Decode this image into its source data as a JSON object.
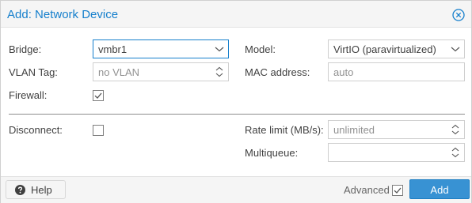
{
  "dialog": {
    "title": "Add: Network Device"
  },
  "fields": {
    "bridge": {
      "label": "Bridge:",
      "value": "vmbr1"
    },
    "vlan_tag": {
      "label": "VLAN Tag:",
      "placeholder": "no VLAN"
    },
    "firewall": {
      "label": "Firewall:",
      "checked": true
    },
    "model": {
      "label": "Model:",
      "value": "VirtIO (paravirtualized)"
    },
    "mac_address": {
      "label": "MAC address:",
      "placeholder": "auto"
    },
    "disconnect": {
      "label": "Disconnect:",
      "checked": false
    },
    "rate_limit": {
      "label": "Rate limit (MB/s):",
      "placeholder": "unlimited"
    },
    "multiqueue": {
      "label": "Multiqueue:",
      "value": ""
    }
  },
  "footer": {
    "help_label": "Help",
    "advanced_label": "Advanced",
    "advanced_checked": true,
    "add_label": "Add"
  },
  "colors": {
    "accent": "#157fcc",
    "primary_button": "#3892d3"
  }
}
